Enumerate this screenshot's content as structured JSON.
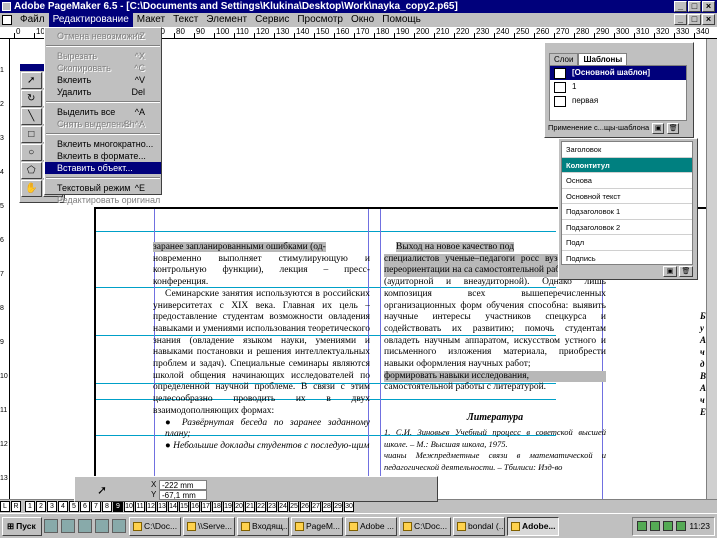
{
  "window": {
    "title": "Adobe PageMaker 6.5 - [C:\\Documents and Settings\\Klukina\\Desktop\\Work\\nayka_copy2.p65]",
    "min": "_",
    "max": "□",
    "close": "×"
  },
  "menubar": [
    "Файл",
    "Редактирование",
    "Макет",
    "Текст",
    "Элемент",
    "Сервис",
    "Просмотр",
    "Окно",
    "Помощь"
  ],
  "edit_menu": {
    "undo": {
      "label": "Отмена невозможна",
      "shortcut": "^Z"
    },
    "cut": {
      "label": "Вырезать",
      "shortcut": "^X"
    },
    "copy": {
      "label": "Скопировать",
      "shortcut": "^C"
    },
    "paste": {
      "label": "Вклеить",
      "shortcut": "^V"
    },
    "clear": {
      "label": "Удалить",
      "shortcut": "Del"
    },
    "select_all": {
      "label": "Выделить все",
      "shortcut": "^A"
    },
    "deselect": {
      "label": "Снять выделение",
      "shortcut": "Sh^A"
    },
    "paste_multiple": {
      "label": "Вклеить многократно..."
    },
    "paste_special": {
      "label": "Вклеить в формате..."
    },
    "insert_object": {
      "label": "Вставить объект..."
    },
    "story_editor": {
      "label": "Текстовый режим",
      "shortcut": "^E"
    },
    "edit_original": {
      "label": "Редактировать оригинал"
    }
  },
  "ruler_top": [
    "0",
    "10",
    "20",
    "30",
    "40",
    "50",
    "60",
    "70",
    "80",
    "90",
    "100",
    "110",
    "120",
    "130",
    "140",
    "150",
    "160",
    "170",
    "180",
    "190",
    "200",
    "210",
    "220",
    "230",
    "240",
    "250",
    "260",
    "270",
    "280",
    "290",
    "300",
    "310",
    "320",
    "330",
    "340"
  ],
  "ruler_left": [
    "1",
    "2",
    "3",
    "4",
    "5",
    "6",
    "7",
    "8",
    "9",
    "10",
    "11",
    "12",
    "13"
  ],
  "master_palette": {
    "tab_styles": "Слои",
    "tab_masters": "Шаблоны",
    "rows": [
      "[Основной шаблон]",
      "1",
      "первая"
    ],
    "footer": "Применение с...щы-шаблона"
  },
  "styles_palette": {
    "items": [
      "Заголовок",
      "Колонтитул",
      "Основа",
      "Основной текст",
      "Подзаголовок 1",
      "Подзаголовок 2",
      "Подл",
      "Подпись"
    ]
  },
  "left_column": {
    "p1a": "заранее запланированными ошибками (од-",
    "p1b": "новременно выполняет стимулирующую и контрольную функции), лекция – пресс-конференция.",
    "p2": "Семинарские занятия используются в российских университетах с XIX века. Главная их цель – предоставление студентам возможности овладения навыками и умениями использования теоретического знания (овладение языком науки, умениями и навыками постановки и решения интеллектуальных проблем и задач). Специальные семинары являются школой общения начинающих исследователей по определенной научной проблеме. В связи с этим целесообразно проводить их в двух взаимодополняющих формах:",
    "b1": "● Развёрнутая беседа по заранее заданному плану;",
    "b2": "● Небольшие доклады студентов с последую-щим"
  },
  "right_column": {
    "p1a": "Выход на новое качество под",
    "p1b": "специалистов ученые–педагоги росс вузов видят в переориентации на са самостоятельной работы",
    "p1c": "(аудиторной и внеаудиторной). Однако лишь композиция всех вышеперечисленных организационных форм обучения способна: выявить научные интересы участников спецкурса и содействовать их развитию; помочь студентам овладеть научным аппаратом, искусством устного и письменного изложения материала, приобрести навыки оформления научных работ;",
    "p1d": "формировать навыки исследования,",
    "p1e": "самостоятельной работы с литературой.",
    "lit_title": "Литература",
    "lit1": "1. С.И. Зиновьев Учебный процесс в советской высшей школе. – М.: Высшая школа, 1975.",
    "lit2": "чианы Межпредметные связи в математической и педагогической деятельности. – Тбилиси: Изд-во"
  },
  "right_edge": [
    "Б",
    "у",
    "А",
    "ч",
    "д",
    "В",
    "А",
    "ч",
    "Е"
  ],
  "coords": {
    "x_label": "X",
    "x_value": "-222 mm",
    "y_label": "Y",
    "y_value": "-67,1 mm"
  },
  "pagebar": {
    "L": "L",
    "R": "R",
    "pages": [
      "1",
      "2",
      "3",
      "4",
      "5",
      "6",
      "7",
      "8",
      "9",
      "10",
      "11",
      "12",
      "13",
      "14",
      "15",
      "16",
      "17",
      "18",
      "19",
      "20",
      "21",
      "22",
      "23",
      "24",
      "25",
      "26",
      "27",
      "28",
      "29",
      "30"
    ],
    "current": "9"
  },
  "taskbar": {
    "start": "Пуск",
    "tasks": [
      "C:\\Doc...",
      "\\\\Serve...",
      "Входящ...",
      "PageM...",
      "Adobe ...",
      "C:\\Doc...",
      "bondal (...",
      "Adobe..."
    ],
    "active_task": "Adobe...",
    "clock": "11:23"
  }
}
